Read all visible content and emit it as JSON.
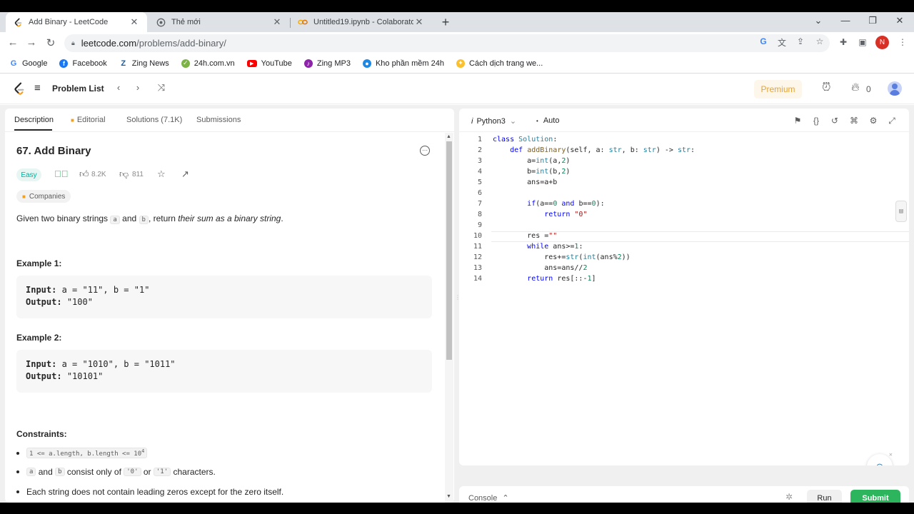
{
  "browser": {
    "tabs": [
      {
        "title": "Add Binary - LeetCode"
      },
      {
        "title": "Thẻ mới"
      },
      {
        "title": "Untitled19.ipynb - Colaboratory"
      }
    ],
    "url_host": "leetcode.com",
    "url_path": "/problems/add-binary/",
    "profile_letter": "N",
    "bookmarks": [
      {
        "label": "Google",
        "icon": "google-icon",
        "color": "#4285f4"
      },
      {
        "label": "Facebook",
        "icon": "facebook-icon",
        "color": "#1877f2"
      },
      {
        "label": "Zing News",
        "icon": "zing-news-icon",
        "color": "#1a5aa0"
      },
      {
        "label": "24h.com.vn",
        "icon": "24h-icon",
        "color": "#7cb342"
      },
      {
        "label": "YouTube",
        "icon": "youtube-icon",
        "color": "#ff0000"
      },
      {
        "label": "Zing MP3",
        "icon": "zing-mp3-icon",
        "color": "#8e24aa"
      },
      {
        "label": "Kho phần mềm 24h",
        "icon": "kho-phan-mem-icon",
        "color": "#1e88e5"
      },
      {
        "label": "Cách dịch trang we...",
        "icon": "translate-page-icon",
        "color": "#fbc02d"
      }
    ]
  },
  "leetcode": {
    "problem_list": "Problem List",
    "premium": "Premium",
    "streak": "0"
  },
  "left": {
    "tabs": [
      "Description",
      "Editorial",
      "Solutions (7.1K)",
      "Submissions"
    ],
    "title": "67. Add Binary",
    "difficulty": "Easy",
    "likes": "8.2K",
    "dislikes": "811",
    "companies": "Companies",
    "desc_pre": "Given two binary strings ",
    "desc_a": "a",
    "desc_and": " and ",
    "desc_b": "b",
    "desc_mid": ", return ",
    "desc_em": "their sum as a binary string",
    "desc_end": ".",
    "examples": [
      {
        "title": "Example 1:",
        "input": "a = \"11\", b = \"1\"",
        "output": "\"100\""
      },
      {
        "title": "Example 2:",
        "input": "a = \"1010\", b = \"1011\"",
        "output": "\"10101\""
      }
    ],
    "input_label": "Input:",
    "output_label": "Output:",
    "constraints_title": "Constraints:",
    "constraint1_code": "1 <= a.length, b.length <= 10",
    "constraint1_sup": "4",
    "constraint2_a": "a",
    "constraint2_and": " and ",
    "constraint2_b": "b",
    "constraint2_mid": " consist only of ",
    "constraint2_zero": "'0'",
    "constraint2_or": " or ",
    "constraint2_one": "'1'",
    "constraint2_end": " characters.",
    "constraint3": "Each string does not contain leading zeros except for the zero itself."
  },
  "editor": {
    "language": "Python3",
    "mode": "Auto",
    "line_numbers": [
      "1",
      "2",
      "3",
      "4",
      "5",
      "6",
      "7",
      "8",
      "9",
      "10",
      "11",
      "12",
      "13",
      "14"
    ]
  },
  "console": {
    "label": "Console",
    "run": "Run",
    "submit": "Submit"
  },
  "colors": {
    "easy": "#00af9b",
    "submit": "#2db55d",
    "premium": "#e3a43a"
  }
}
